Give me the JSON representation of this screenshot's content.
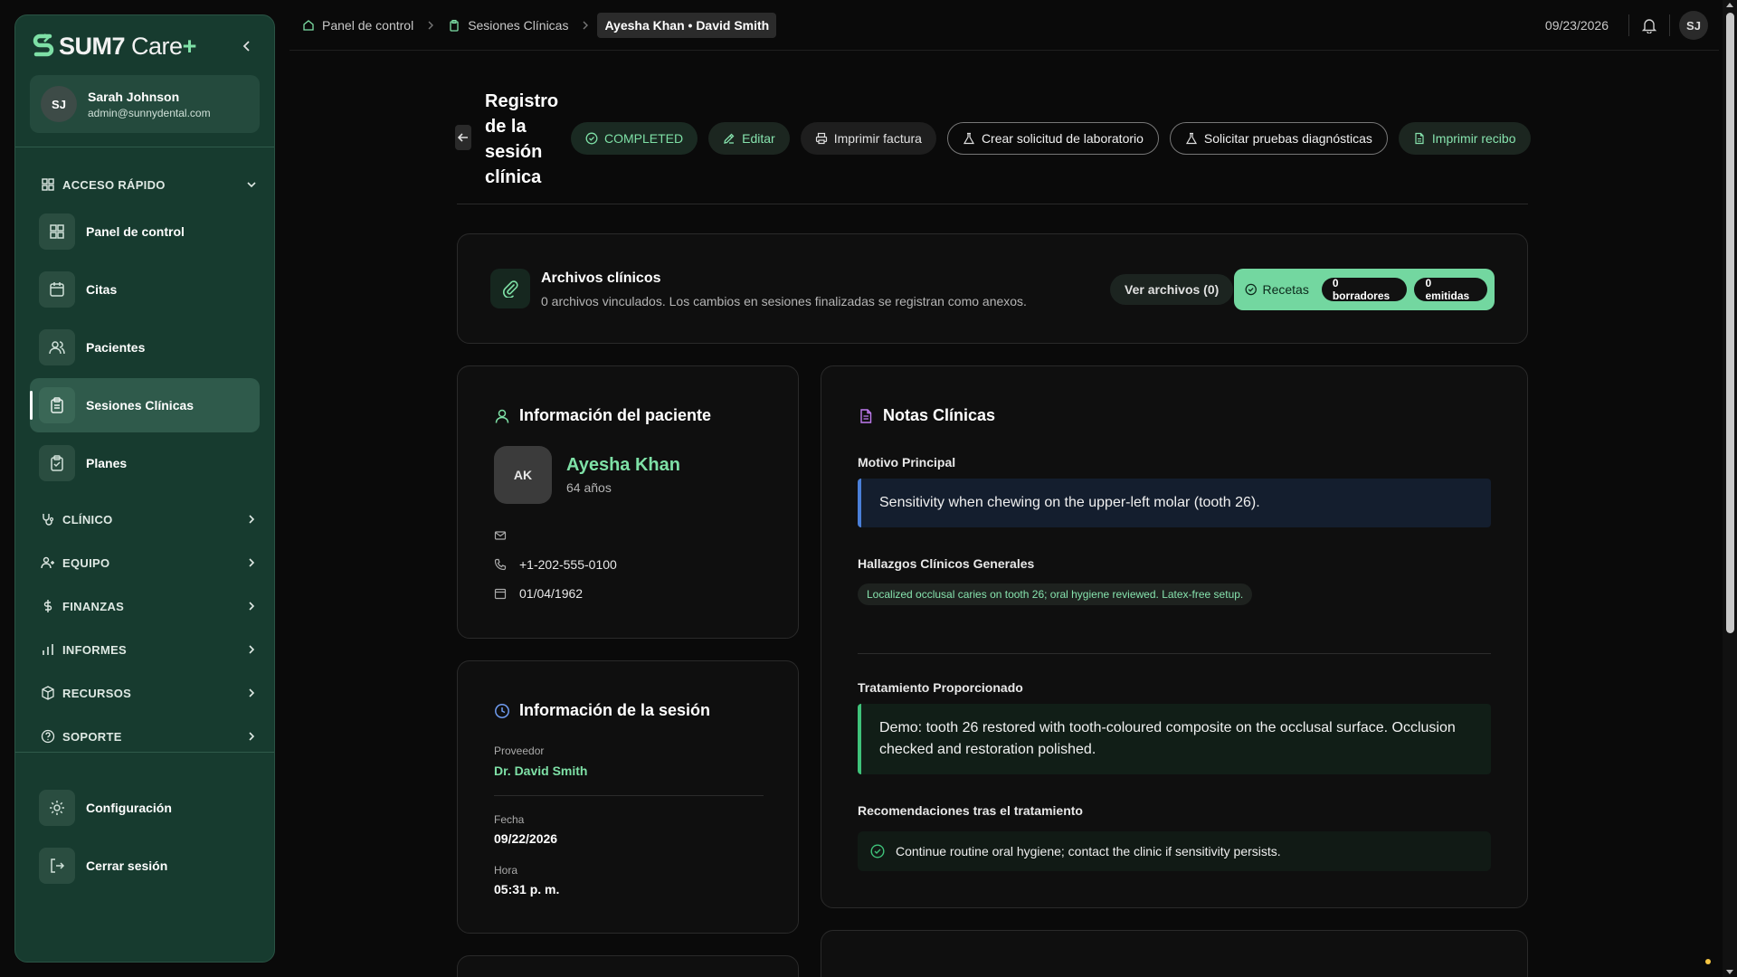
{
  "brand": {
    "name": "SUM7",
    "product": "Care",
    "plus": "+"
  },
  "user": {
    "initials": "SJ",
    "name": "Sarah Johnson",
    "email": "admin@sunnydental.com"
  },
  "sidebar": {
    "quick_access": "ACCESO RÁPIDO",
    "items": [
      {
        "label": "Panel de control",
        "icon": "grid-icon"
      },
      {
        "label": "Citas",
        "icon": "calendar-icon"
      },
      {
        "label": "Pacientes",
        "icon": "users-icon"
      },
      {
        "label": "Sesiones Clínicas",
        "icon": "clipboard-icon",
        "active": true
      },
      {
        "label": "Planes",
        "icon": "clipboard-check-icon"
      }
    ],
    "sections": [
      "CLÍNICO",
      "EQUIPO",
      "FINANZAS",
      "INFORMES",
      "RECURSOS",
      "SOPORTE"
    ],
    "bottom": [
      {
        "label": "Configuración",
        "icon": "gear-icon"
      },
      {
        "label": "Cerrar sesión",
        "icon": "logout-icon"
      }
    ]
  },
  "topbar": {
    "breadcrumbs": [
      "Panel de control",
      "Sesiones Clínicas",
      "Ayesha Khan • David Smith"
    ],
    "date": "09/23/2026",
    "avatar": "SJ"
  },
  "page": {
    "title": "Registro de la sesión clínica",
    "status": "COMPLETED",
    "actions": {
      "edit": "Editar",
      "print_invoice": "Imprimir factura",
      "lab_request": "Crear solicitud de laboratorio",
      "diagnostics": "Solicitar pruebas diagnósticas",
      "print_receipt": "Imprimir recibo"
    }
  },
  "files": {
    "title": "Archivos clínicos",
    "subtitle": "0 archivos vinculados. Los cambios en sesiones finalizadas se registran como anexos.",
    "view_button": "Ver archivos (0)",
    "recipes_label": "Recetas",
    "drafts": "0 borradores",
    "issued": "0 emitidas"
  },
  "patient": {
    "section_title": "Información del paciente",
    "initials": "AK",
    "name": "Ayesha Khan",
    "age": "64 años",
    "email": "",
    "phone": "+1-202-555-0100",
    "dob": "01/04/1962"
  },
  "session": {
    "section_title": "Información de la sesión",
    "provider_label": "Proveedor",
    "provider": "Dr. David Smith",
    "date_label": "Fecha",
    "date": "09/22/2026",
    "time_label": "Hora",
    "time": "05:31 p. m."
  },
  "notes": {
    "section_title": "Notas Clínicas",
    "chief_label": "Motivo Principal",
    "chief": "Sensitivity when chewing on the upper-left molar (tooth 26).",
    "findings_label": "Hallazgos Clínicos Generales",
    "findings": "Localized occlusal caries on tooth 26; oral hygiene reviewed. Latex-free setup.",
    "treatment_label": "Tratamiento Proporcionado",
    "treatment": "Demo: tooth 26 restored with tooth-coloured composite on the occlusal surface. Occlusion checked and restoration polished.",
    "recommendations_label": "Recomendaciones tras el tratamiento",
    "recommendation": "Continue routine oral hygiene; contact the clinic if sensitivity persists."
  },
  "colors": {
    "accent": "#7ee0a6",
    "sidebar_bg": "#173b2f",
    "page_bg": "#0a0a0a",
    "chief_border": "#4a7fd8",
    "treatment_border": "#3fc37a"
  }
}
